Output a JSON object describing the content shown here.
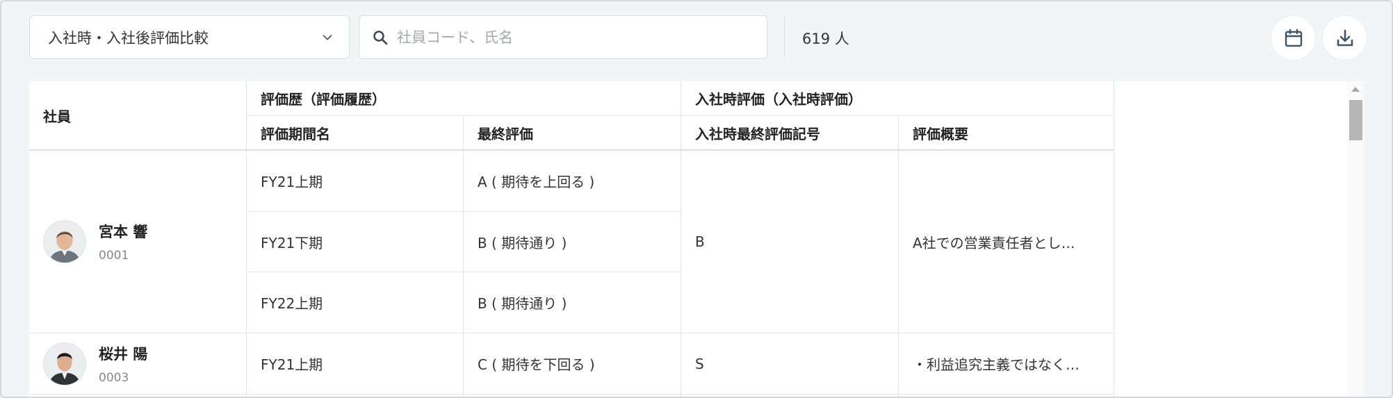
{
  "toolbar": {
    "select_value": "入社時・入社後評価比較",
    "search_placeholder": "社員コード、氏名",
    "count": "619 人",
    "calendar_icon": "calendar-icon",
    "download_icon": "download-icon"
  },
  "table": {
    "headers": {
      "employee": "社員",
      "history_group": "評価歴（評価履歴）",
      "entry_group": "入社時評価（入社時評価）",
      "period_name": "評価期間名",
      "final_rating": "最終評価",
      "entry_final_mark": "入社時最終評価記号",
      "summary": "評価概要"
    },
    "employees": [
      {
        "name": "宮本 響",
        "code": "0001",
        "history": [
          {
            "period": "FY21上期",
            "rating": "A ( 期待を上回る )"
          },
          {
            "period": "FY21下期",
            "rating": "B ( 期待通り )"
          },
          {
            "period": "FY22上期",
            "rating": "B ( 期待通り )"
          }
        ],
        "entry_mark": "B",
        "summary": "A社での営業責任者とし…"
      },
      {
        "name": "桜井 陽",
        "code": "0003",
        "history": [
          {
            "period": "FY21上期",
            "rating": "C ( 期待を下回る )"
          }
        ],
        "entry_mark": "S",
        "summary": "・利益追究主義ではなく…"
      }
    ]
  }
}
